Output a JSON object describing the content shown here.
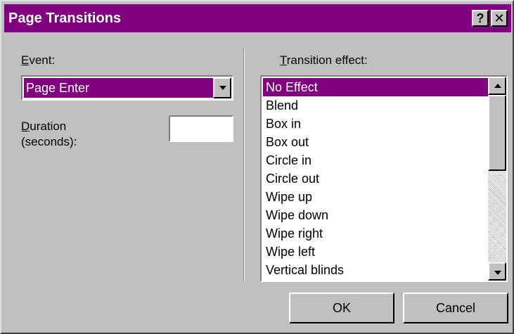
{
  "window": {
    "title": "Page Transitions",
    "help_label": "?",
    "close_label": "✕"
  },
  "event": {
    "label_mnemonic": "E",
    "label_rest": "vent:",
    "selected_value": "Page Enter"
  },
  "duration": {
    "label_mnemonic": "D",
    "label_rest": "uration",
    "label_line2": "(seconds):",
    "value": ""
  },
  "transition": {
    "label_mnemonic": "T",
    "label_rest": "ransition effect:",
    "selected_index": 0,
    "items": [
      "No Effect",
      "Blend",
      "Box in",
      "Box out",
      "Circle in",
      "Circle out",
      "Wipe up",
      "Wipe down",
      "Wipe right",
      "Wipe left",
      "Vertical blinds"
    ]
  },
  "buttons": {
    "ok_label": "OK",
    "cancel_label": "Cancel"
  },
  "colors": {
    "face": "#c0c0c0",
    "highlight": "#800080",
    "highlight_text": "#ffffff"
  },
  "icons": {
    "combo_arrow": "chevron-down-icon",
    "scroll_up": "arrow-up-icon",
    "scroll_down": "arrow-down-icon"
  }
}
